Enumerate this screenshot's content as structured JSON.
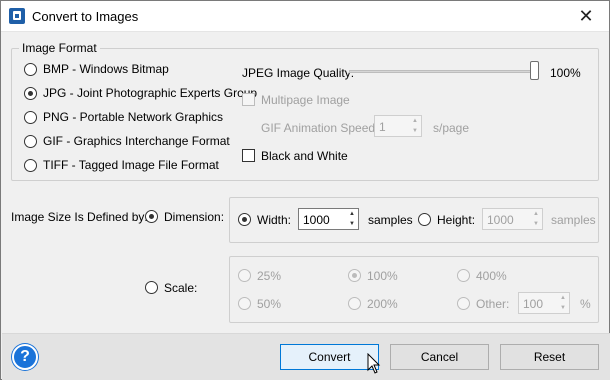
{
  "window": {
    "title": "Convert to Images"
  },
  "format_group": {
    "legend": "Image Format",
    "options": [
      {
        "label": "BMP - Windows Bitmap",
        "checked": false
      },
      {
        "label": "JPG - Joint Photographic Experts Group",
        "checked": true
      },
      {
        "label": "PNG - Portable Network Graphics",
        "checked": false
      },
      {
        "label": "GIF - Graphics Interchange Format",
        "checked": false
      },
      {
        "label": "TIFF - Tagged Image File Format",
        "checked": false
      }
    ],
    "jpeg_quality_label": "JPEG Image Quality:",
    "jpeg_quality_value": "100%",
    "jpeg_quality_fraction": 1.0,
    "multipage_label": "Multipage Image",
    "gif_speed_label": "GIF Animation Speed:",
    "gif_speed_value": "1",
    "gif_speed_unit": "s/page",
    "black_white_label": "Black and White"
  },
  "size": {
    "label": "Image Size Is Defined by:",
    "dimension_label": "Dimension:",
    "width_label": "Width:",
    "width_value": "1000",
    "width_unit": "samples",
    "height_label": "Height:",
    "height_value": "1000",
    "height_unit": "samples",
    "scale_label": "Scale:",
    "scale_options": [
      "25%",
      "100%",
      "400%",
      "50%",
      "200%"
    ],
    "other_label": "Other:",
    "other_value": "100",
    "other_unit": "%"
  },
  "buttons": {
    "help": "?",
    "convert": "Convert",
    "cancel": "Cancel",
    "reset": "Reset"
  }
}
